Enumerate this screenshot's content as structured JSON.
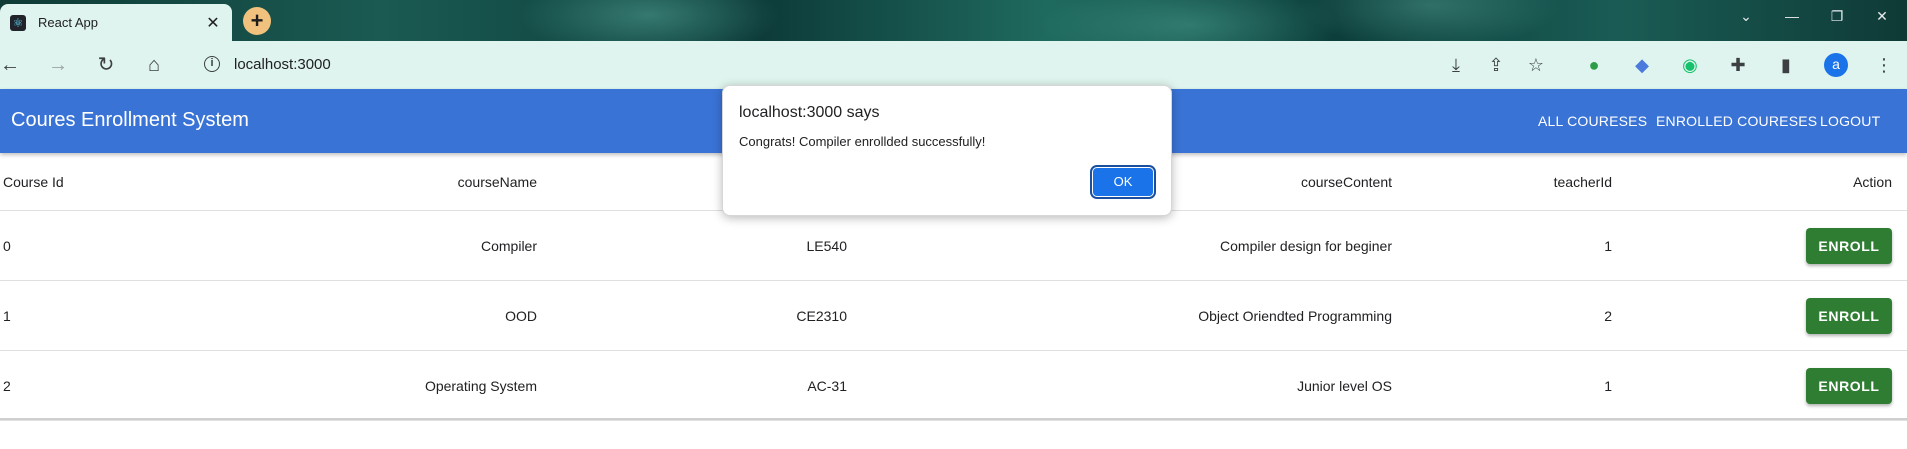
{
  "browser": {
    "tab_title": "React App",
    "tab_close": "✕",
    "new_tab": "+",
    "url": "localhost:3000",
    "avatar_letter": "a"
  },
  "app": {
    "title": "Coures Enrollment System",
    "nav": [
      "ALL COURESES",
      "ENROLLED COURESES",
      "LOGOUT"
    ]
  },
  "table": {
    "headers": {
      "id": "Course Id",
      "name": "courseName",
      "content": "courseContent",
      "teacher": "teacherId",
      "action": "Action"
    },
    "rows": [
      {
        "id": "0",
        "name": "Compiler",
        "code": "LE540",
        "content": "Compiler design for beginer",
        "teacher": "1",
        "action": "ENROLL"
      },
      {
        "id": "1",
        "name": "OOD",
        "code": "CE2310",
        "content": "Object Oriendted Programming",
        "teacher": "2",
        "action": "ENROLL"
      },
      {
        "id": "2",
        "name": "Operating System",
        "code": "AC-31",
        "content": "Junior level OS",
        "teacher": "1",
        "action": "ENROLL"
      }
    ]
  },
  "dialog": {
    "title": "localhost:3000 says",
    "message": "Congrats! Compiler enrollded successfully!",
    "ok_label": "OK"
  },
  "colors": {
    "appbar": "#3a73d6",
    "enroll_button": "#2e7d32",
    "dialog_ok": "#1a73e8"
  }
}
